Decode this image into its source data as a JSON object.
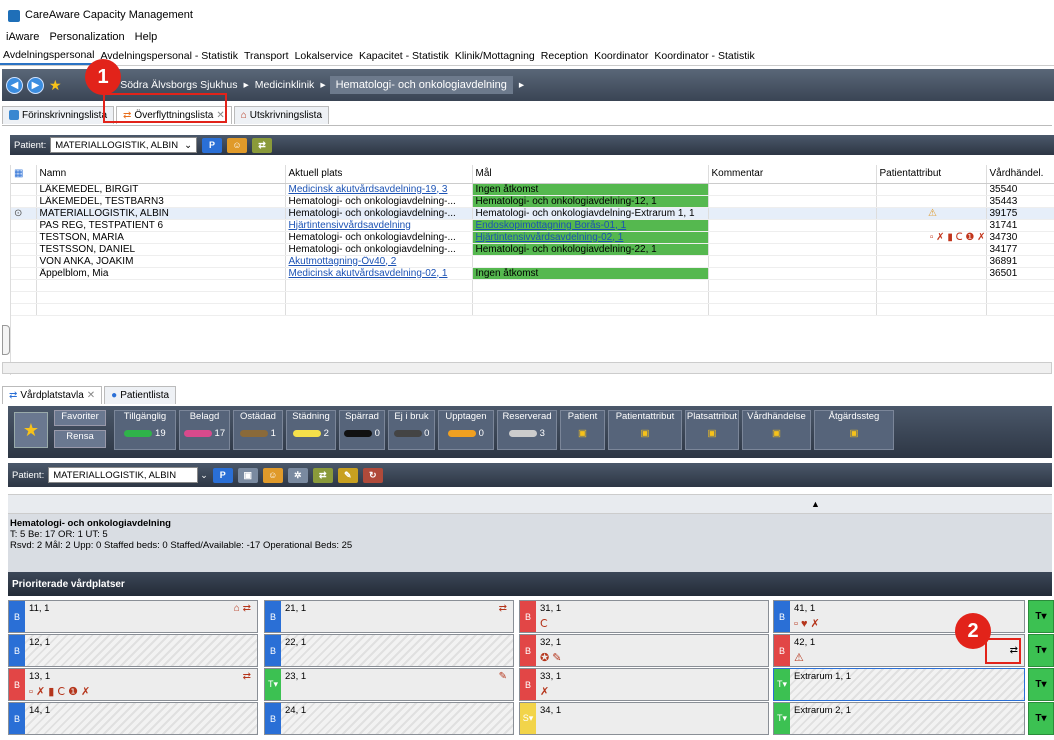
{
  "app": {
    "title": "CareAware Capacity Management"
  },
  "menu": [
    "iAware",
    "Personalization",
    "Help"
  ],
  "nav_tabs": [
    "Avdelningspersonal",
    "Avdelningspersonal - Statistik",
    "Transport",
    "Lokalservice",
    "Kapacitet - Statistik",
    "Klinik/Mottagning",
    "Reception",
    "Koordinator",
    "Koordinator - Statistik"
  ],
  "breadcrumb": [
    "Södra Älvsborgs Sjukhus",
    "Medicinklinik",
    "Hematologi- och onkologiavdelning"
  ],
  "doc_tabs": [
    "Förinskrivningslista",
    "Överflyttningslista",
    "Utskrivningslista"
  ],
  "patient_bar": {
    "label": "Patient:",
    "selected": "MATERIALLOGISTIK, ALBIN"
  },
  "table": {
    "headers": [
      "Namn",
      "Aktuell plats",
      "Mål",
      "Kommentar",
      "Patientattribut",
      "Vårdhändel."
    ],
    "rows": [
      {
        "name": "LÄKEMEDEL, BIRGIT",
        "plats": "Medicinsk akutvårdsavdelning-19, 3",
        "mal": "Ingen åtkomst",
        "komm": "",
        "attr": "",
        "vh": "35540"
      },
      {
        "name": "LÄKEMEDEL, TESTBARN3",
        "plats": "Hematologi- och onkologiavdelning-...",
        "mal": "Hematologi- och onkologiavdelning-12, 1",
        "komm": "",
        "attr": "",
        "vh": "35443"
      },
      {
        "name": "MATERIALLOGISTIK, ALBIN",
        "plats": "Hematologi- och onkologiavdelning-...",
        "mal": "Hematologi- och onkologiavdelning-Extrarum 1, 1",
        "komm": "",
        "attr": "⚠",
        "vh": "39175"
      },
      {
        "name": "PAS REG, TESTPATIENT 6",
        "plats": "Hjärtintensivvårdsavdelning",
        "mal": "Endoskopimottagning Borås-01, 1",
        "komm": "",
        "attr": "",
        "vh": "31741"
      },
      {
        "name": "TESTSON, MARIA",
        "plats": "Hematologi- och onkologiavdelning-...",
        "mal": "Hjärtintensivvårdsavdelning-02, 1",
        "komm": "",
        "attr": "▫ ✗ ▮ Ⅽ ❶ ✗",
        "vh": "34730"
      },
      {
        "name": "TESTSSON, DANIEL",
        "plats": "Hematologi- och onkologiavdelning-...",
        "mal": "Hematologi- och onkologiavdelning-22, 1",
        "komm": "",
        "attr": "",
        "vh": "34177"
      },
      {
        "name": "VON ANKA, JOAKIM",
        "plats": "Akutmottagning-Öv40, 2",
        "mal": "",
        "komm": "",
        "attr": "",
        "vh": "36891"
      },
      {
        "name": "Äppelblom, Mia",
        "plats": "Medicinsk akutvårdsavdelning-02, 1",
        "mal": "Ingen åtkomst",
        "komm": "",
        "attr": "",
        "vh": "36501"
      }
    ]
  },
  "low_tabs": [
    "Vårdplatstavla",
    "Patientlista"
  ],
  "status_bar": {
    "favoriter": "Favoriter",
    "rensa": "Rensa",
    "items": [
      {
        "label": "Tillgänglig",
        "count": "19",
        "color": "#2fb34a"
      },
      {
        "label": "Belagd",
        "count": "17",
        "color": "#d94a8c"
      },
      {
        "label": "Ostädad",
        "count": "1",
        "color": "#8a6a3a"
      },
      {
        "label": "Städning",
        "count": "2",
        "color": "#f5e04a"
      },
      {
        "label": "Spärrad",
        "count": "0",
        "color": "#111111"
      },
      {
        "label": "Ej i bruk",
        "count": "0",
        "color": "#444444"
      },
      {
        "label": "Upptagen",
        "count": "0",
        "color": "#f0a020"
      },
      {
        "label": "Reserverad",
        "count": "3",
        "color": "#cccccc"
      }
    ],
    "filters": [
      "Patient",
      "Patientattribut",
      "Platsattribut",
      "Vårdhändelse",
      "Åtgärdssteg"
    ]
  },
  "unit": {
    "name": "Hematologi- och onkologiavdelning",
    "line1": "T: 5 Be: 17 OR: 1 UT: 5",
    "line2": "Rsvd: 2 Mål: 2 Upp: 0 Staffed beds: 0 Staffed/Available: -17 Operational Beds: 25"
  },
  "prio_title": "Prioriterade vårdplatser",
  "beds": [
    {
      "id": "11, 1",
      "tag": "B"
    },
    {
      "id": "21, 1",
      "tag": "B"
    },
    {
      "id": "31, 1",
      "tag": "B"
    },
    {
      "id": "41, 1",
      "tag": "B"
    },
    {
      "id": "12, 1",
      "tag": "B"
    },
    {
      "id": "22, 1",
      "tag": "B"
    },
    {
      "id": "32, 1",
      "tag": "B"
    },
    {
      "id": "42, 1",
      "tag": "B"
    },
    {
      "id": "13, 1",
      "tag": "B"
    },
    {
      "id": "23, 1",
      "tag": "T▾"
    },
    {
      "id": "33, 1",
      "tag": "B"
    },
    {
      "id": "Extrarum 1, 1",
      "tag": "T▾"
    },
    {
      "id": "14, 1",
      "tag": "B"
    },
    {
      "id": "24, 1",
      "tag": "B"
    },
    {
      "id": "34, 1",
      "tag": "S▾"
    },
    {
      "id": "Extrarum 2, 1",
      "tag": "T▾"
    }
  ],
  "side_tag": "T▾",
  "callouts": [
    "1",
    "2"
  ],
  "colors": {
    "blue_tag": "#2a6fd6",
    "red_tag": "#e24646",
    "green_tag": "#3cc152",
    "yellow_tag": "#f2d44a",
    "callout": "#e2231a"
  }
}
